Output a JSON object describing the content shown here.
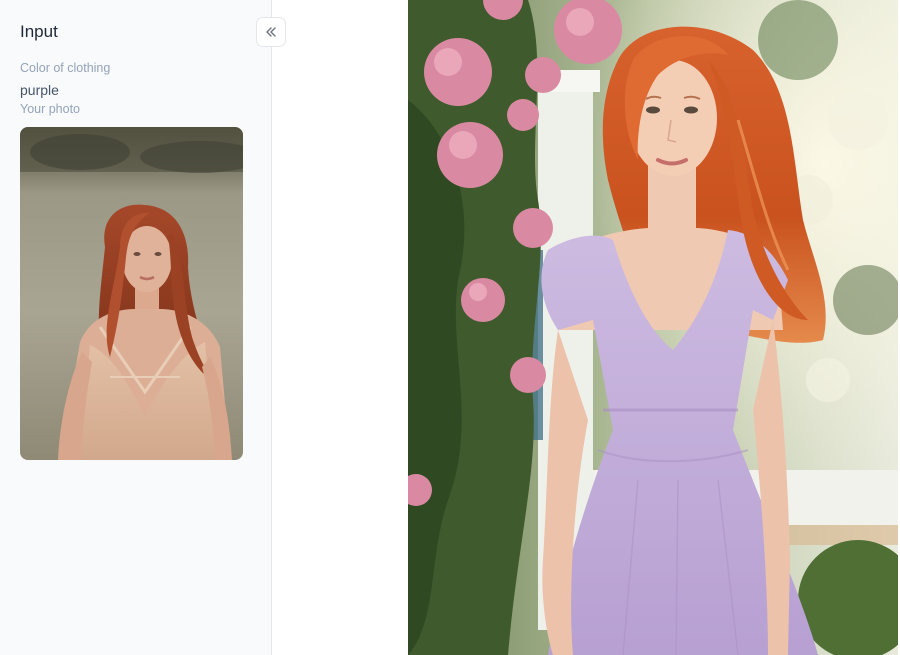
{
  "input_panel": {
    "title": "Input",
    "color_label": "Color of clothing",
    "color_value": "purple",
    "photo_label": "Your photo",
    "photo_alt": "Uploaded photo of a woman with red hair wearing a peach dress"
  },
  "controls": {
    "collapse_icon": "double-chevron-left-icon"
  },
  "result": {
    "image_alt": "Generated photo of a woman with red hair wearing a purple dress next to pink flowers"
  },
  "colors": {
    "panel_background": "#f8fafc",
    "title_text": "#1f2937",
    "label_text": "#94a3b8",
    "value_text": "#475569",
    "border": "#e5e7eb",
    "dress_purple": "#c7b4de"
  }
}
